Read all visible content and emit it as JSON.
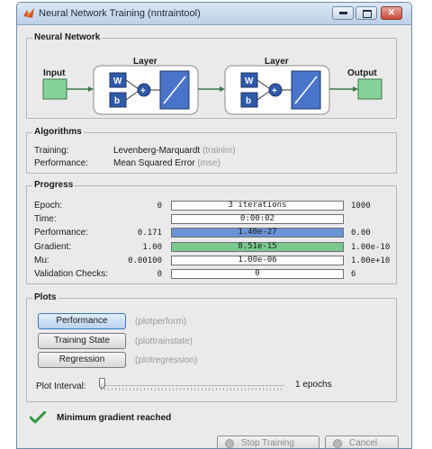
{
  "window": {
    "title": "Neural Network Training (nntraintool)"
  },
  "network": {
    "section_title": "Neural Network",
    "input_label": "Input",
    "output_label": "Output",
    "layers": [
      {
        "title": "Layer",
        "weight": "W",
        "bias": "b",
        "sum": "+"
      },
      {
        "title": "Layer",
        "weight": "W",
        "bias": "b",
        "sum": "+"
      }
    ]
  },
  "algorithms": {
    "section_title": "Algorithms",
    "rows": [
      {
        "label": "Training:",
        "value": "Levenberg-Marquardt",
        "func": "(trainlm)"
      },
      {
        "label": "Performance:",
        "value": "Mean Squared Error",
        "func": "(mse)"
      }
    ]
  },
  "progress": {
    "section_title": "Progress",
    "rows": [
      {
        "label": "Epoch:",
        "start": "0",
        "current": "3 iterations",
        "end": "1000",
        "fill": 0.003,
        "color": "#ffffff"
      },
      {
        "label": "Time:",
        "start": "",
        "current": "0:00:02",
        "end": "",
        "fill": 0,
        "color": "#ffffff"
      },
      {
        "label": "Performance:",
        "start": "0.171",
        "current": "1.40e-27",
        "end": "0.00",
        "fill": 1.0,
        "color": "#6b93d6"
      },
      {
        "label": "Gradient:",
        "start": "1.00",
        "current": "8.51e-15",
        "end": "1.00e-10",
        "fill": 1.0,
        "color": "#79c98e"
      },
      {
        "label": "Mu:",
        "start": "0.00100",
        "current": "1.00e-06",
        "end": "1.00e+10",
        "fill": 0,
        "color": "#ffffff"
      },
      {
        "label": "Validation Checks:",
        "start": "0",
        "current": "0",
        "end": "6",
        "fill": 0,
        "color": "#ffffff"
      }
    ]
  },
  "plots": {
    "section_title": "Plots",
    "buttons": [
      {
        "label": "Performance",
        "func": "(plotperform)"
      },
      {
        "label": "Training State",
        "func": "(plottrainstate)"
      },
      {
        "label": "Regression",
        "func": "(plotregression)"
      }
    ],
    "interval_label": "Plot Interval:",
    "interval_value": "1 epochs"
  },
  "status": {
    "icon": "checkmark-icon",
    "text": "Minimum gradient reached"
  },
  "footer": {
    "stop_label": "Stop Training",
    "cancel_label": "Cancel"
  }
}
